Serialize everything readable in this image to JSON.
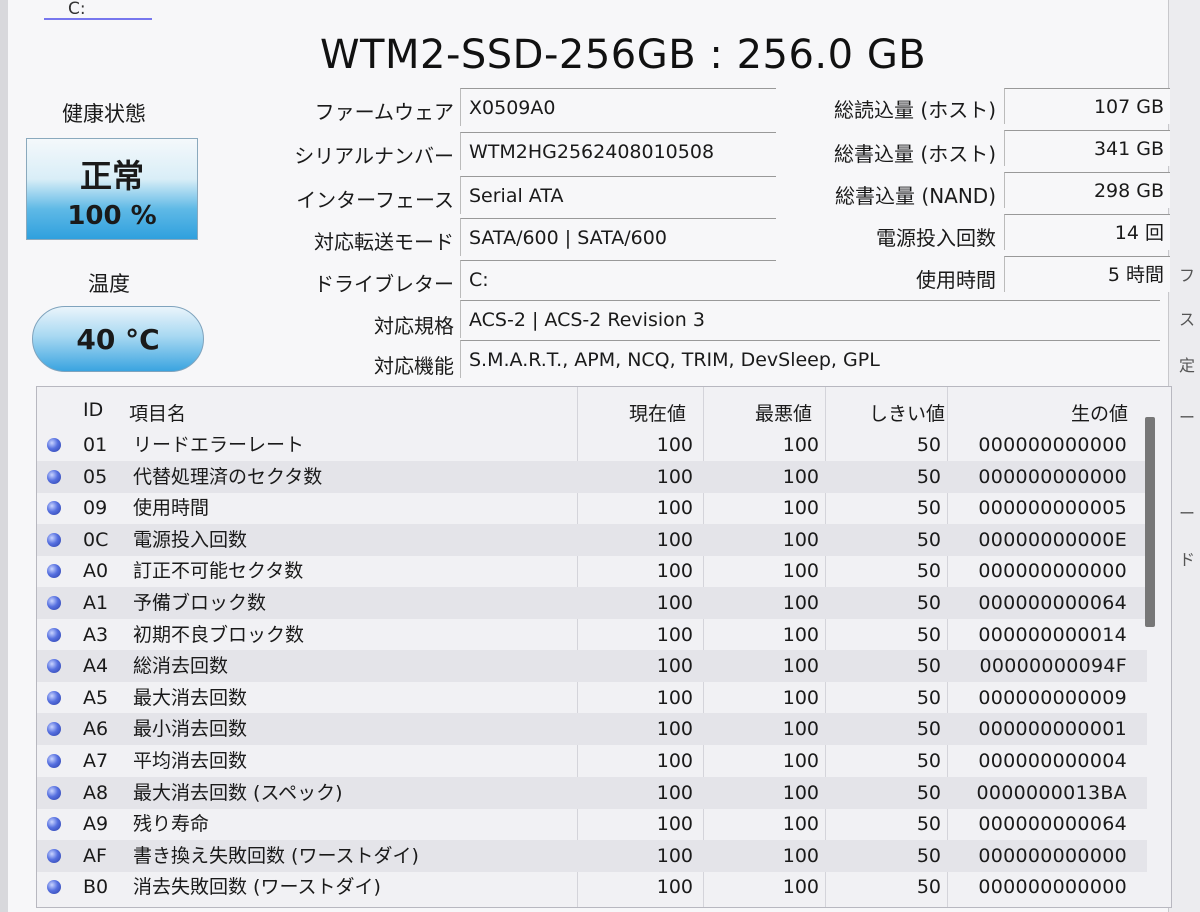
{
  "tab": {
    "drive": "C:"
  },
  "title": "WTM2-SSD-256GB : 256.0 GB",
  "health": {
    "label": "健康状態",
    "status": "正常",
    "percent": "100 %"
  },
  "temperature": {
    "label": "温度",
    "value": "40 °C"
  },
  "info": [
    {
      "label": "ファームウェア",
      "value": "X0509A0"
    },
    {
      "label": "シリアルナンバー",
      "value": "WTM2HG2562408010508"
    },
    {
      "label": "インターフェース",
      "value": "Serial ATA"
    },
    {
      "label": "対応転送モード",
      "value": "SATA/600 | SATA/600"
    },
    {
      "label": "ドライブレター",
      "value": "C:"
    },
    {
      "label": "対応規格",
      "value": "ACS-2 | ACS-2 Revision 3"
    },
    {
      "label": "対応機能",
      "value": "S.M.A.R.T., APM, NCQ, TRIM, DevSleep, GPL"
    }
  ],
  "stats": [
    {
      "label": "総読込量 (ホスト)",
      "value": "107 GB"
    },
    {
      "label": "総書込量 (ホスト)",
      "value": "341 GB"
    },
    {
      "label": "総書込量 (NAND)",
      "value": "298 GB"
    },
    {
      "label": "電源投入回数",
      "value": "14 回"
    },
    {
      "label": "使用時間",
      "value": "5 時間"
    }
  ],
  "smart": {
    "columns": {
      "id": "ID",
      "name": "項目名",
      "current": "現在値",
      "worst": "最悪値",
      "threshold": "しきい値",
      "raw": "生の値"
    },
    "rows": [
      {
        "id": "01",
        "name": "リードエラーレート",
        "current": "100",
        "worst": "100",
        "threshold": "50",
        "raw": "000000000000"
      },
      {
        "id": "05",
        "name": "代替処理済のセクタ数",
        "current": "100",
        "worst": "100",
        "threshold": "50",
        "raw": "000000000000"
      },
      {
        "id": "09",
        "name": "使用時間",
        "current": "100",
        "worst": "100",
        "threshold": "50",
        "raw": "000000000005"
      },
      {
        "id": "0C",
        "name": "電源投入回数",
        "current": "100",
        "worst": "100",
        "threshold": "50",
        "raw": "00000000000E"
      },
      {
        "id": "A0",
        "name": "訂正不可能セクタ数",
        "current": "100",
        "worst": "100",
        "threshold": "50",
        "raw": "000000000000"
      },
      {
        "id": "A1",
        "name": "予備ブロック数",
        "current": "100",
        "worst": "100",
        "threshold": "50",
        "raw": "000000000064"
      },
      {
        "id": "A3",
        "name": "初期不良ブロック数",
        "current": "100",
        "worst": "100",
        "threshold": "50",
        "raw": "000000000014"
      },
      {
        "id": "A4",
        "name": "総消去回数",
        "current": "100",
        "worst": "100",
        "threshold": "50",
        "raw": "00000000094F"
      },
      {
        "id": "A5",
        "name": "最大消去回数",
        "current": "100",
        "worst": "100",
        "threshold": "50",
        "raw": "000000000009"
      },
      {
        "id": "A6",
        "name": "最小消去回数",
        "current": "100",
        "worst": "100",
        "threshold": "50",
        "raw": "000000000001"
      },
      {
        "id": "A7",
        "name": "平均消去回数",
        "current": "100",
        "worst": "100",
        "threshold": "50",
        "raw": "000000000004"
      },
      {
        "id": "A8",
        "name": "最大消去回数 (スペック)",
        "current": "100",
        "worst": "100",
        "threshold": "50",
        "raw": "0000000013BA"
      },
      {
        "id": "A9",
        "name": "残り寿命",
        "current": "100",
        "worst": "100",
        "threshold": "50",
        "raw": "000000000064"
      },
      {
        "id": "AF",
        "name": "書き換え失敗回数 (ワーストダイ)",
        "current": "100",
        "worst": "100",
        "threshold": "50",
        "raw": "000000000000"
      },
      {
        "id": "B0",
        "name": "消去失敗回数 (ワーストダイ)",
        "current": "100",
        "worst": "100",
        "threshold": "50",
        "raw": "000000000000"
      }
    ]
  },
  "side_fragments": [
    "フ",
    "ス",
    "定",
    "ー",
    "ー",
    "ド"
  ]
}
